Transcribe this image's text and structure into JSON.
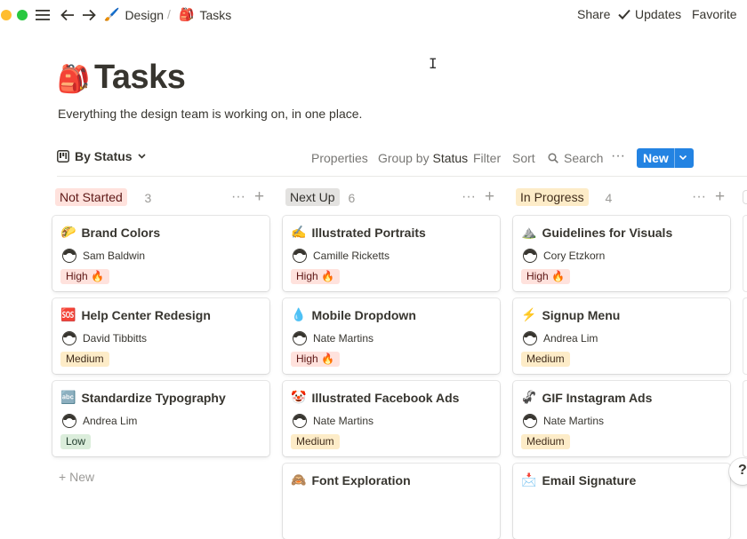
{
  "topbar": {
    "breadcrumbs": [
      {
        "icon": "🖌️",
        "label": "Design"
      },
      {
        "icon": "🎒",
        "label": "Tasks"
      }
    ],
    "separator": "/",
    "share_label": "Share",
    "updates_label": "Updates",
    "favorite_label": "Favorite",
    "more_label": "···"
  },
  "page": {
    "icon": "🎒",
    "title": "Tasks",
    "description": "Everything the design team is working on, in one place."
  },
  "viewbar": {
    "view_label": "By Status",
    "properties_label": "Properties",
    "group_by_label": "Group by",
    "group_by_value": "Status",
    "filter_label": "Filter",
    "sort_label": "Sort",
    "search_label": "Search",
    "more_label": "···",
    "new_label": "New"
  },
  "columns": [
    {
      "name": "Not Started",
      "count": "3",
      "color": "#ffe2dd",
      "cards": [
        {
          "icon": "🌮",
          "title": "Brand Colors",
          "person": "Sam Baldwin",
          "priority": "High 🔥",
          "level": "high"
        },
        {
          "icon": "🆘",
          "title": "Help Center Redesign",
          "person": "David Tibbitts",
          "priority": "Medium",
          "level": "med"
        },
        {
          "icon": "🔤",
          "title": "Standardize Typography",
          "person": "Andrea Lim",
          "priority": "Low",
          "level": "low"
        }
      ]
    },
    {
      "name": "Next Up",
      "count": "6",
      "color": "#e3e2e0",
      "cards": [
        {
          "icon": "✍️",
          "title": "Illustrated Portraits",
          "person": "Camille Ricketts",
          "priority": "High 🔥",
          "level": "high"
        },
        {
          "icon": "💧",
          "title": "Mobile Dropdown",
          "person": "Nate Martins",
          "priority": "High 🔥",
          "level": "high"
        },
        {
          "icon": "🤡",
          "title": "Illustrated Facebook Ads",
          "person": "Nate Martins",
          "priority": "Medium",
          "level": "med"
        },
        {
          "icon": "🙈",
          "title": "Font Exploration",
          "person": "",
          "priority": "",
          "level": ""
        }
      ]
    },
    {
      "name": "In Progress",
      "count": "4",
      "color": "#fdecc8",
      "cards": [
        {
          "icon": "⛰️",
          "title": "Guidelines for Visuals",
          "person": "Cory Etzkorn",
          "priority": "High 🔥",
          "level": "high"
        },
        {
          "icon": "⚡",
          "title": "Signup Menu",
          "person": "Andrea Lim",
          "priority": "Medium",
          "level": "med"
        },
        {
          "icon": "🦨",
          "title": "GIF Instagram Ads",
          "person": "Nate Martins",
          "priority": "Medium",
          "level": "med"
        },
        {
          "icon": "📩",
          "title": "Email Signature",
          "person": "",
          "priority": "",
          "level": ""
        }
      ]
    }
  ],
  "add_new_label": "New",
  "help_label": "?"
}
